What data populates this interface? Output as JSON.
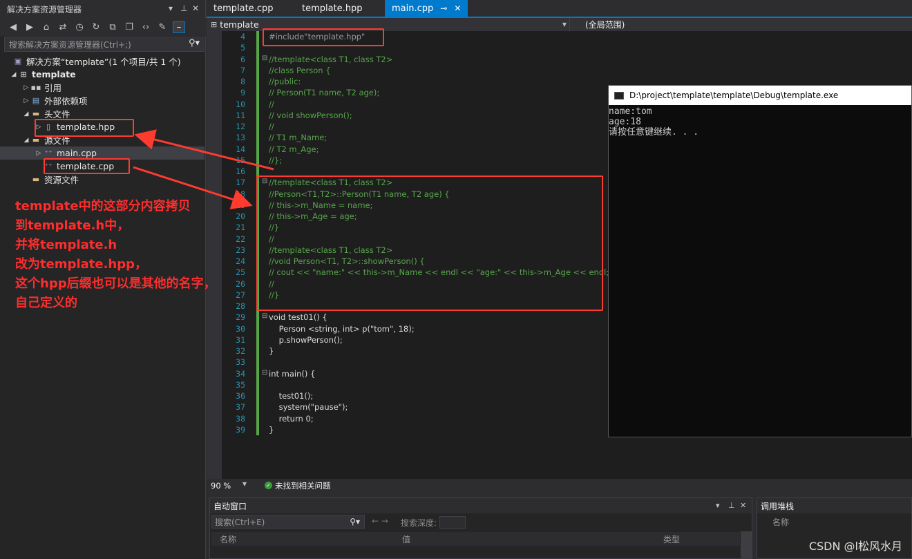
{
  "solution_explorer": {
    "title": "解决方案资源管理器",
    "title_controls": [
      "▾",
      "⊥",
      "✕"
    ],
    "toolbar_icons": [
      "back-icon",
      "forward-icon",
      "home-icon",
      "switch-views-icon",
      "history-icon",
      "sync-icon",
      "collapse-all-icon",
      "show-all-files-icon",
      "code-view-icon",
      "properties-wrench-icon",
      "pin-icon"
    ],
    "search_placeholder": "搜索解决方案资源管理器(Ctrl+;)",
    "tree": [
      {
        "label": "解决方案“template”(1 个项目/共 1 个)",
        "depth": 0,
        "expanded": null,
        "icon": "solution-icon"
      },
      {
        "label": "template",
        "depth": 0,
        "expanded": true,
        "icon": "project-icon"
      },
      {
        "label": "引用",
        "depth": 1,
        "expanded": false,
        "icon": "references-icon"
      },
      {
        "label": "外部依赖项",
        "depth": 1,
        "expanded": false,
        "icon": "external-deps-icon"
      },
      {
        "label": "头文件",
        "depth": 1,
        "expanded": true,
        "icon": "folder-icon"
      },
      {
        "label": "template.hpp",
        "depth": 2,
        "expanded": false,
        "icon": "header-file-icon"
      },
      {
        "label": "源文件",
        "depth": 1,
        "expanded": true,
        "icon": "folder-icon"
      },
      {
        "label": "main.cpp",
        "depth": 2,
        "expanded": false,
        "icon": "cpp-file-icon"
      },
      {
        "label": "template.cpp",
        "depth": 2,
        "expanded": null,
        "icon": "cpp-file-icon"
      },
      {
        "label": "资源文件",
        "depth": 1,
        "expanded": null,
        "icon": "folder-icon"
      }
    ]
  },
  "tabs": [
    {
      "label": "template.cpp",
      "active": false
    },
    {
      "label": "template.hpp",
      "active": false
    },
    {
      "label": "main.cpp",
      "active": true,
      "pin": "⊸",
      "close": "✕"
    }
  ],
  "navbar": {
    "project": "template",
    "scope": "(全局范围)"
  },
  "editor": {
    "line_numbers": [
      "4",
      "5",
      "6",
      "7",
      "8",
      "9",
      "10",
      "11",
      "12",
      "13",
      "14",
      "15",
      "16",
      "17",
      "18",
      "19",
      "20",
      "21",
      "22",
      "23",
      "24",
      "25",
      "26",
      "27",
      "28",
      "29",
      "30",
      "31",
      "32",
      "33",
      "34",
      "35",
      "36",
      "37",
      "38",
      "39"
    ],
    "lines": [
      "#include\"template.hpp\"",
      "",
      "//template<class T1, class T2>",
      "//class Person {",
      "//public:",
      "// Person(T1 name, T2 age);",
      "//",
      "// void showPerson();",
      "//",
      "// T1 m_Name;",
      "// T2 m_Age;",
      "//};",
      "",
      "//template<class T1, class T2>",
      "//Person<T1,T2>::Person(T1 name, T2 age) {",
      "// this->m_Name = name;",
      "// this->m_Age = age;",
      "//}",
      "//",
      "//template<class T1, class T2>",
      "//void Person<T1, T2>::showPerson() {",
      "// cout << \"name:\" << this->m_Name << endl << \"age:\" << this->m_Age << endl;",
      "//",
      "//}",
      "",
      "void test01() {",
      "    Person <string, int> p(\"tom\", 18);",
      "    p.showPerson();",
      "}",
      "",
      "int main() {",
      "",
      "    test01();",
      "    system(\"pause\");",
      "    return 0;",
      "}"
    ]
  },
  "console": {
    "title": "D:\\project\\template\\template\\Debug\\template.exe",
    "output": [
      "name:tom",
      "age:18",
      "请按任意键继续. . ."
    ]
  },
  "statusbar": {
    "zoom": "90 %",
    "issues": "未找到相关问题"
  },
  "autos": {
    "title": "自动窗口",
    "search_placeholder": "搜索(Ctrl+E)",
    "search_depth_label": "搜索深度:",
    "columns": [
      "名称",
      "值",
      "类型"
    ]
  },
  "callstack": {
    "title": "调用堆栈",
    "column": "名称"
  },
  "annotation": {
    "lines": [
      "template中的这部分内容拷贝",
      "到template.h中，",
      "并将template.h",
      "改为template.hpp，",
      "这个hpp后缀也可以是其他的名字，",
      "自己定义的"
    ],
    "color": "#ff2d2d"
  },
  "watermark": "CSDN @l松风水月",
  "colors": {
    "accent": "#007acc",
    "comment": "#57a64a",
    "keyword": "#569cd6",
    "annotation_red": "#ff3b30"
  }
}
